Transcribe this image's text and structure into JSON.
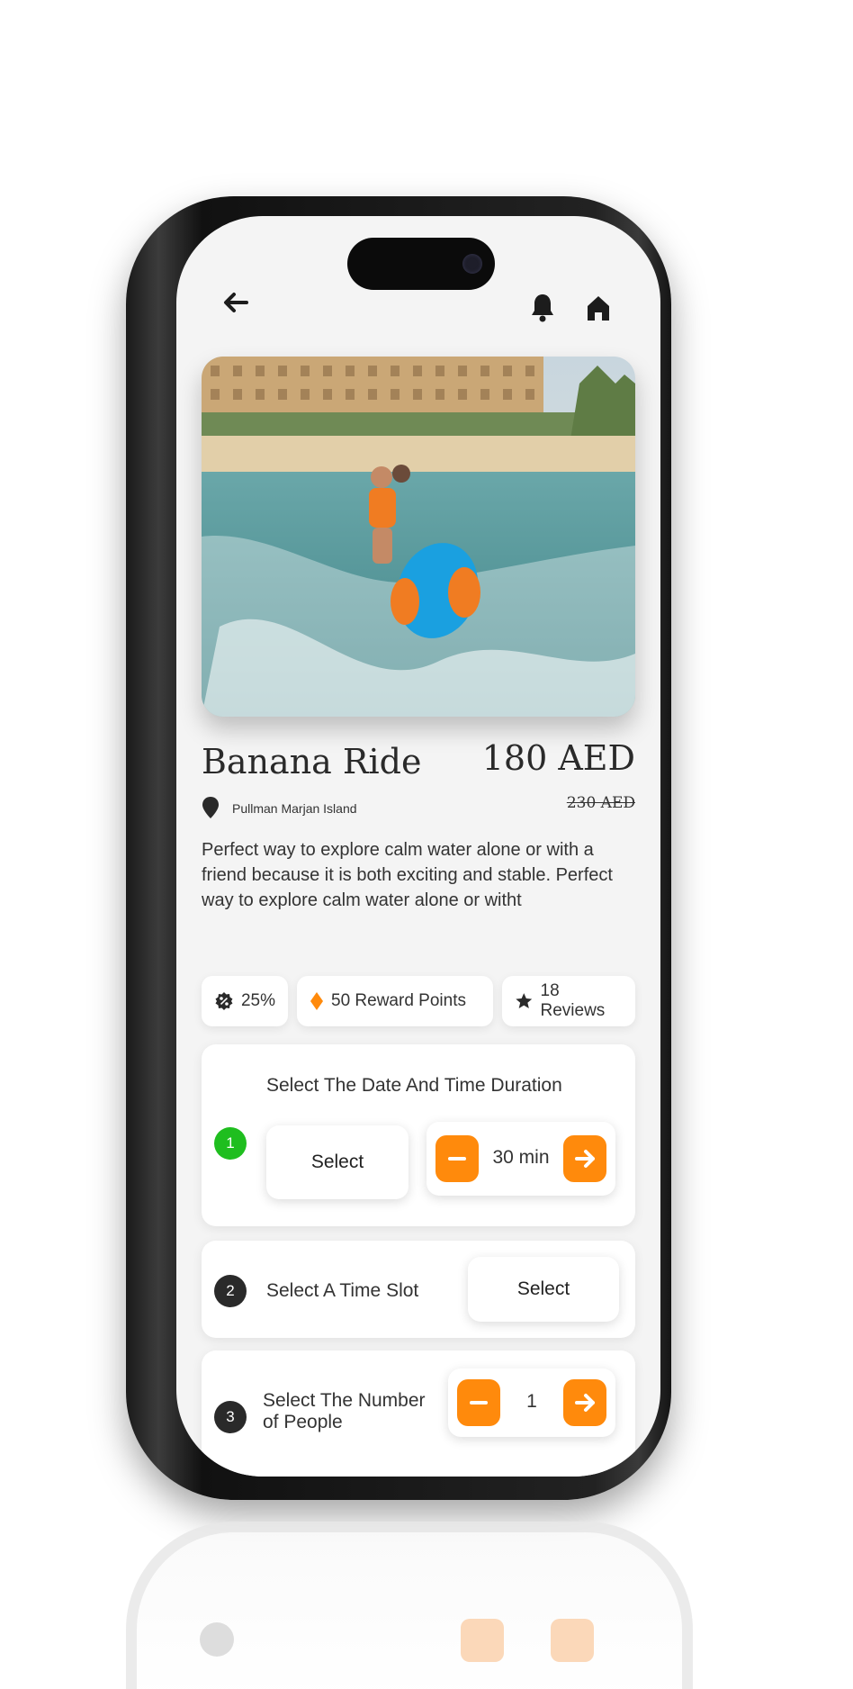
{
  "header": {
    "back_icon": "arrow-left-icon",
    "notification_icon": "bell-icon",
    "home_icon": "home-icon"
  },
  "product": {
    "title": "Banana Ride",
    "price": "180 AED",
    "old_price": "230 AED",
    "location": "Pullman Marjan Island",
    "description": "Perfect way to explore calm water alone or with a friend because it is both exciting and stable. Perfect way to explore calm water alone or witht"
  },
  "chips": [
    {
      "icon": "discount-badge-icon",
      "label": "25%"
    },
    {
      "icon": "diamond-icon",
      "label": "50 Reward Points"
    },
    {
      "icon": "star-icon",
      "label": "18 Reviews"
    }
  ],
  "steps": [
    {
      "number": "1",
      "label": "Select The Date And Time Duration",
      "select_label": "Select",
      "duration": "30 min",
      "status_color": "#1fbe1f"
    },
    {
      "number": "2",
      "label": "Select A Time Slot",
      "select_label": "Select"
    },
    {
      "number": "3",
      "label": "Select The Number\nof People",
      "count": "1"
    }
  ],
  "colors": {
    "accent": "#ff8a0c",
    "step_active": "#1fbe1f",
    "step_default": "#2a2a2a"
  }
}
